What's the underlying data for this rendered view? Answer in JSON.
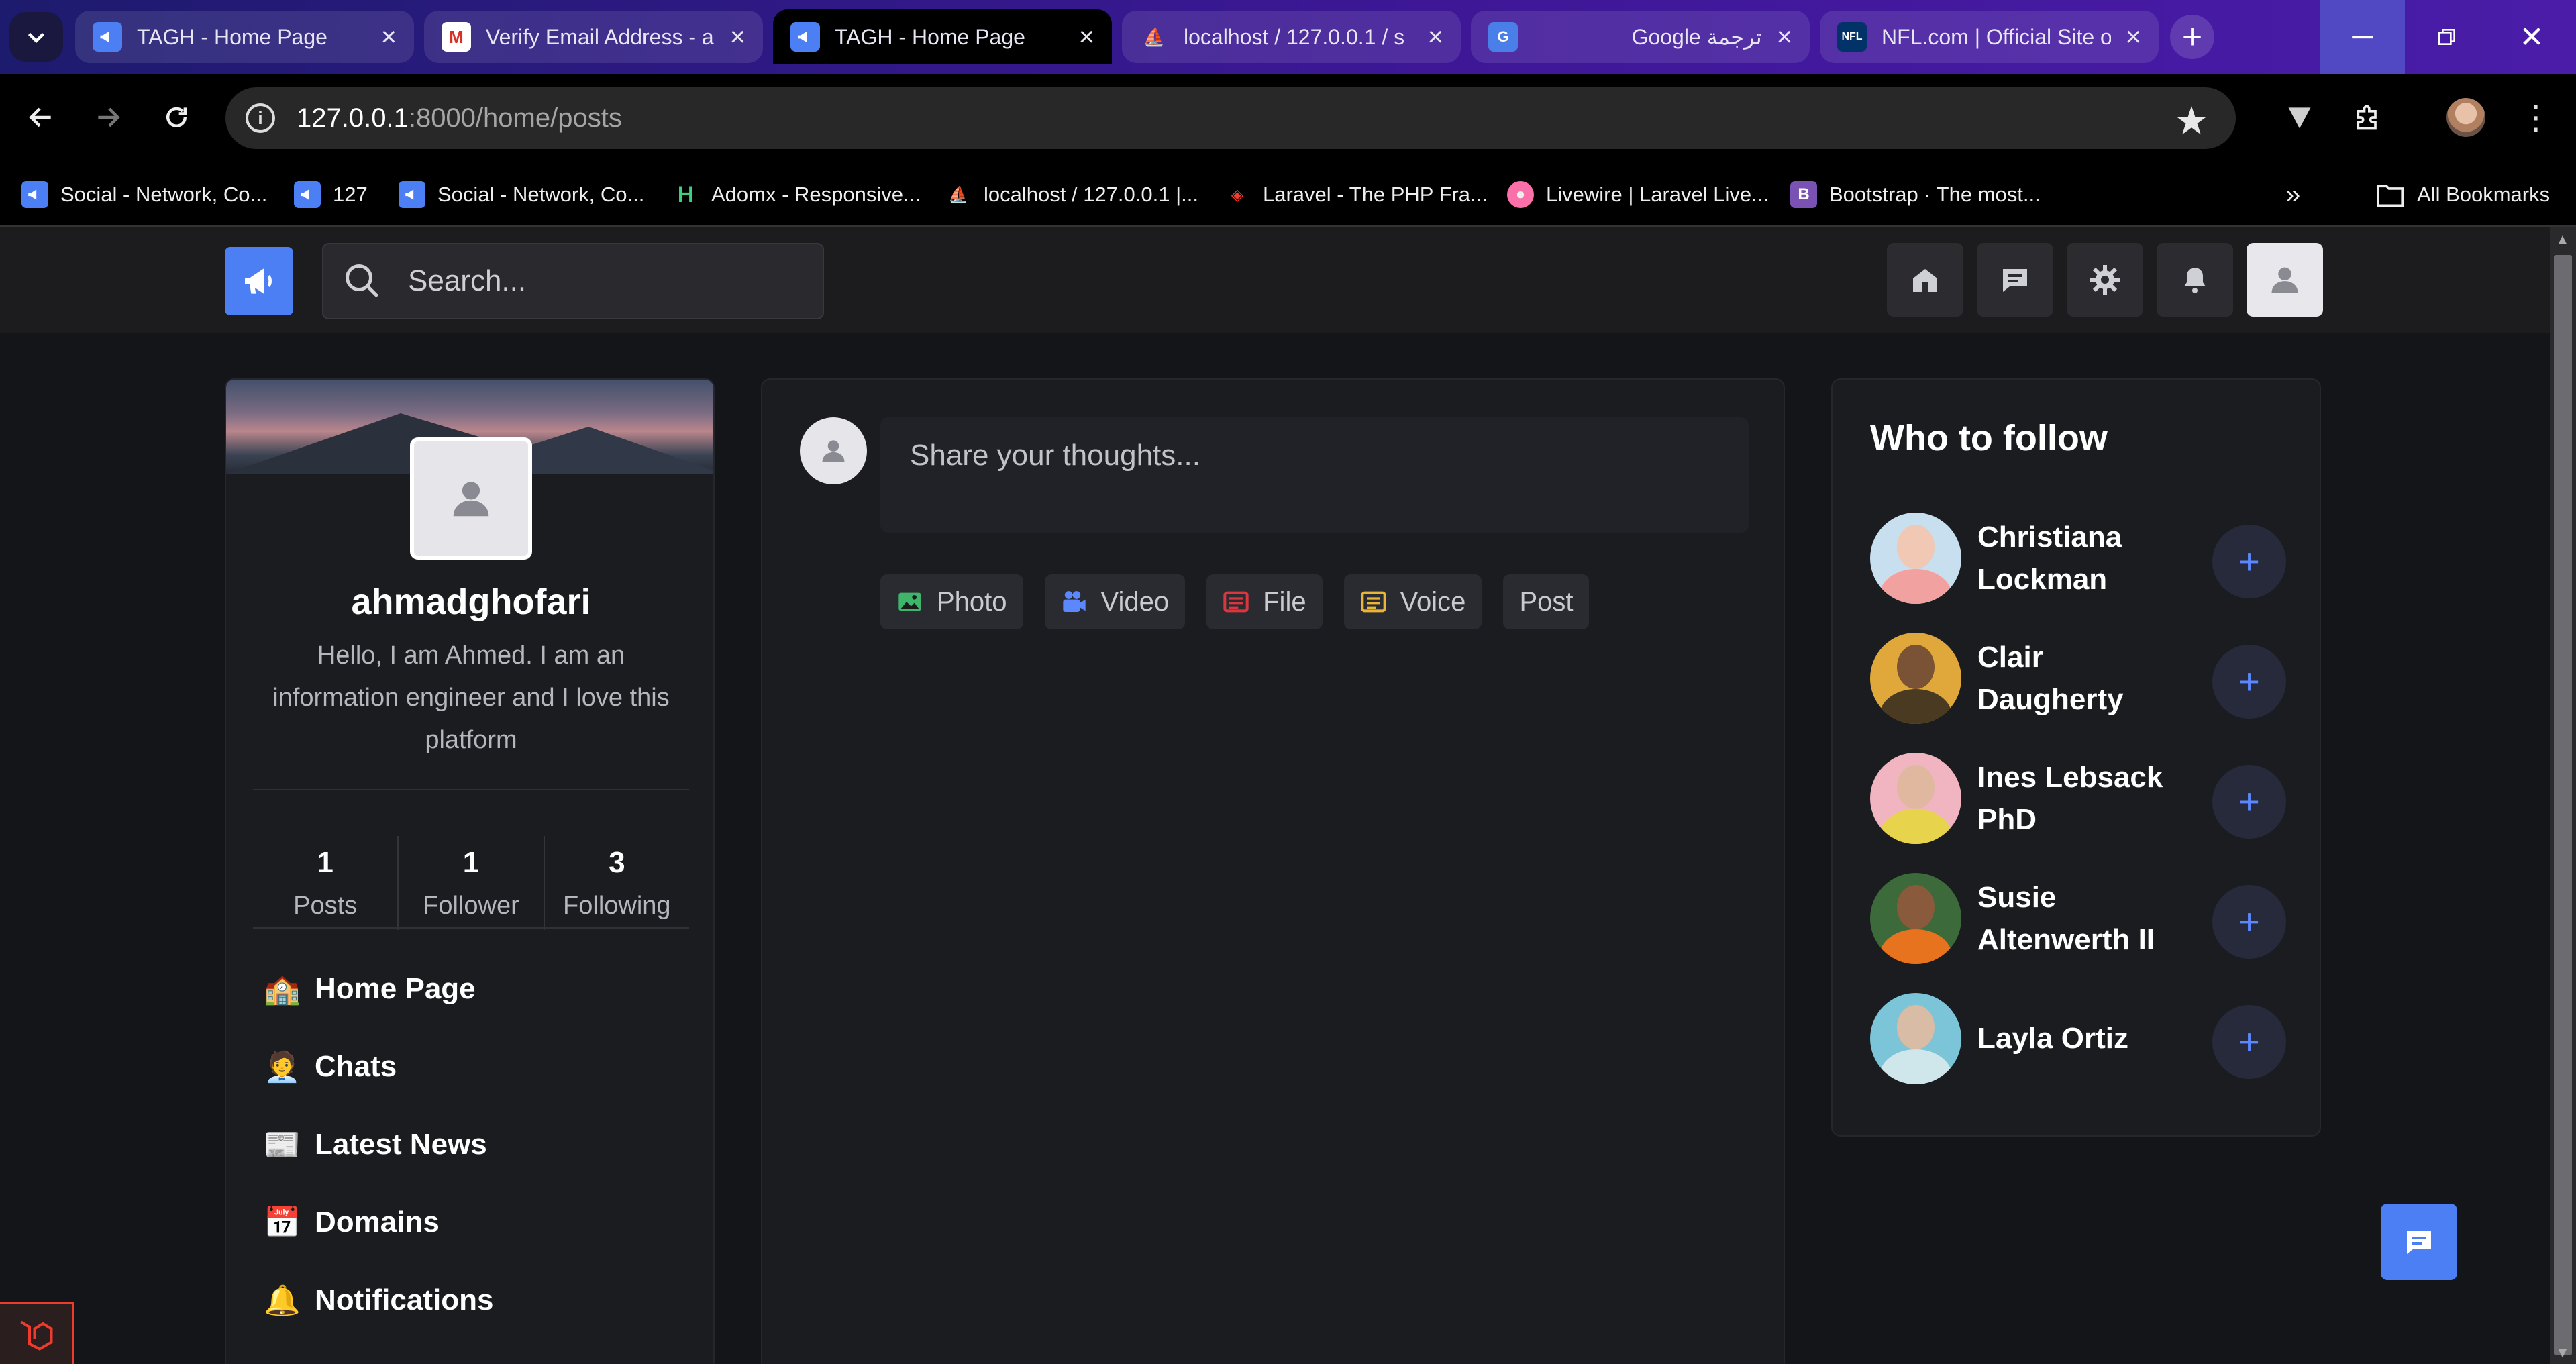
{
  "browser": {
    "tabs": [
      {
        "title": "TAGH - Home Page",
        "favicon": "tagh-logo-icon",
        "active": false
      },
      {
        "title": "Verify Email Address - a",
        "favicon": "gmail-icon",
        "active": false
      },
      {
        "title": "TAGH - Home Page",
        "favicon": "tagh-logo-icon",
        "active": true
      },
      {
        "title": "localhost / 127.0.0.1 / s",
        "favicon": "phpmyadmin-icon",
        "active": false
      },
      {
        "title": "Google ترجمة",
        "favicon": "google-translate-icon",
        "active": false
      },
      {
        "title": "NFL.com | Official Site o",
        "favicon": "nfl-icon",
        "active": false
      }
    ],
    "url_host": "127.0.0.1",
    "url_rest": ":8000/home/posts",
    "bookmarks": [
      {
        "label": "Social - Network, Co...",
        "favicon": "tagh-logo-icon"
      },
      {
        "label": "127",
        "favicon": "tagh-logo-icon"
      },
      {
        "label": "Social - Network, Co...",
        "favicon": "tagh-logo-icon"
      },
      {
        "label": "Adomx - Responsive...",
        "favicon": "adomx-icon"
      },
      {
        "label": "localhost / 127.0.0.1 |...",
        "favicon": "phpmyadmin-icon"
      },
      {
        "label": "Laravel - The PHP Fra...",
        "favicon": "laravel-icon"
      },
      {
        "label": "Livewire | Laravel Live...",
        "favicon": "livewire-icon"
      },
      {
        "label": "Bootstrap · The most...",
        "favicon": "bootstrap-icon"
      }
    ],
    "all_bookmarks_label": "All Bookmarks"
  },
  "header": {
    "search_placeholder": "Search...",
    "icons": [
      "home-icon",
      "chat-icon",
      "gear-icon",
      "bell-icon",
      "user-icon"
    ]
  },
  "profile": {
    "username": "ahmadghofari",
    "bio": "Hello, I am Ahmed. I am an information engineer and I love this platform",
    "stats": [
      {
        "value": "1",
        "label": "Posts"
      },
      {
        "value": "1",
        "label": "Follower"
      },
      {
        "value": "3",
        "label": "Following"
      }
    ],
    "nav": [
      {
        "emoji": "🏫",
        "label": "Home Page"
      },
      {
        "emoji": "🧑‍💼",
        "label": "Chats"
      },
      {
        "emoji": "📰",
        "label": "Latest News"
      },
      {
        "emoji": "📅",
        "label": "Domains"
      },
      {
        "emoji": "🔔",
        "label": "Notifications"
      }
    ]
  },
  "composer": {
    "placeholder": "Share your thoughts...",
    "actions": [
      {
        "label": "Photo",
        "icon": "image-icon",
        "color": "#3fb56a"
      },
      {
        "label": "Video",
        "icon": "video-icon",
        "color": "#5b87ff"
      },
      {
        "label": "File",
        "icon": "file-icon",
        "color": "#d9363e"
      },
      {
        "label": "Voice",
        "icon": "voice-icon",
        "color": "#e8b53a"
      },
      {
        "label": "Post",
        "icon": "",
        "color": ""
      }
    ]
  },
  "who_to_follow": {
    "title": "Who to follow",
    "people": [
      {
        "name": "Christiana Lockman"
      },
      {
        "name": "Clair Daugherty"
      },
      {
        "name": "Ines Lebsack PhD"
      },
      {
        "name": "Susie Altenwerth II"
      },
      {
        "name": "Layla Ortiz"
      }
    ]
  },
  "colors": {
    "accent": "#4b7ff3",
    "background": "#141519",
    "card": "#1b1c20",
    "tabbar_gradient_start": "#1d1b6e",
    "tabbar_gradient_end": "#4a1ca8"
  }
}
